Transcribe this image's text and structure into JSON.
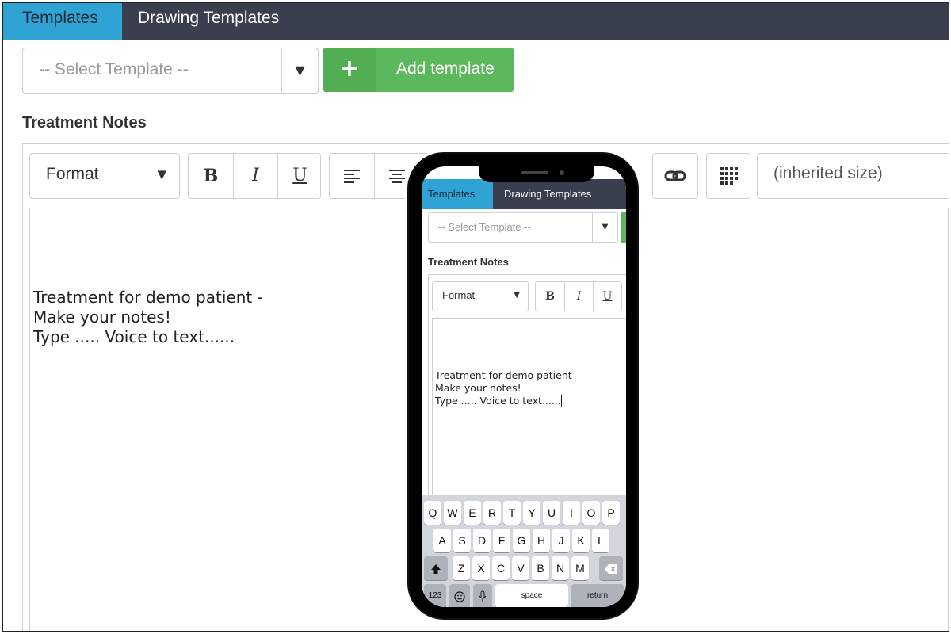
{
  "tabs": {
    "templates": "Templates",
    "drawing_templates": "Drawing Templates"
  },
  "template_select": {
    "placeholder": "-- Select Template --",
    "arrow": "▼"
  },
  "add_template": {
    "icon": "plus-icon",
    "label": "Add template",
    "plus_glyph": "+"
  },
  "section_title": "Treatment Notes",
  "toolbar": {
    "format_label": "Format",
    "format_arrow": "▼",
    "bold": "B",
    "italic": "I",
    "underline": "U",
    "font_size": "(inherited size)"
  },
  "editor": {
    "line1": "Treatment for demo patient -",
    "line2": "Make your notes!",
    "line3": "",
    "line4": "Type ..... Voice to text......"
  },
  "keyboard": {
    "row1": [
      "Q",
      "W",
      "E",
      "R",
      "T",
      "Y",
      "U",
      "I",
      "O",
      "P"
    ],
    "row2": [
      "A",
      "S",
      "D",
      "F",
      "G",
      "H",
      "J",
      "K",
      "L"
    ],
    "row3": [
      "Z",
      "X",
      "C",
      "V",
      "B",
      "N",
      "M"
    ],
    "numbers": "123",
    "space": "space",
    "return": "return",
    "shift_icon": "shift-icon",
    "backspace_icon": "backspace-icon",
    "emoji_icon": "emoji-icon",
    "mic_icon": "microphone-icon"
  },
  "colors": {
    "tab_active": "#2fa3d3",
    "tabbar": "#3a3f4f",
    "add_button": "#5cb85c"
  }
}
